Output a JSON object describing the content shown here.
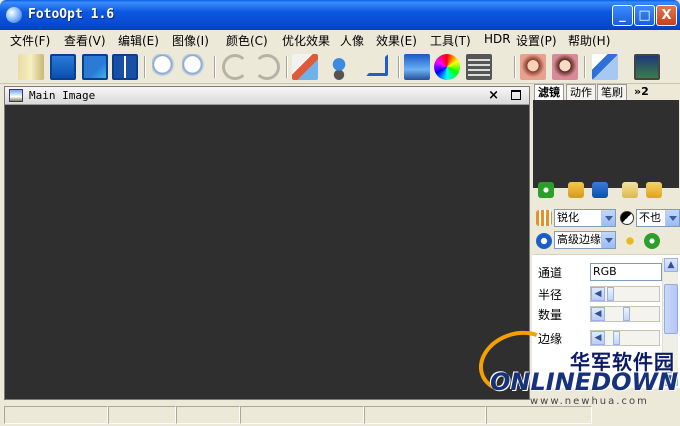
{
  "window": {
    "title": "FotoOpt 1.6",
    "minimize": "_",
    "maximize": "□",
    "close": "X"
  },
  "menu": [
    "文件(F)",
    "查看(V)",
    "编辑(E)",
    "图像(I)",
    "颜色(C)",
    "优化效果",
    "人像",
    "效果(E)",
    "工具(T)",
    "HDR",
    "设置(P)",
    "帮助(H)"
  ],
  "toolbar": {
    "icons": [
      "open-icon",
      "save-icon",
      "save-as-icon",
      "compare-icon",
      "zoom-in-icon",
      "zoom-out-icon",
      "undo-icon",
      "redo-icon",
      "resize-icon",
      "brush-icon",
      "crop-icon",
      "landscape-icon",
      "color-wheel-icon",
      "film-icon",
      "portrait-icon",
      "portrait-beauty-icon",
      "pen-icon",
      "export-icon"
    ]
  },
  "main_image": {
    "title": "Main Image",
    "close": "×"
  },
  "panel": {
    "tabs": [
      "滤镜",
      "动作",
      "笔刷",
      "»2"
    ],
    "filter_combo": "锐化",
    "mode_combo": "不也",
    "edge_combo": "高级边缘",
    "params": [
      {
        "label": "通道",
        "value": "RGB"
      },
      {
        "label": "半径",
        "value": ""
      },
      {
        "label": "数量",
        "value": ""
      },
      {
        "label": "边缘",
        "value": ""
      }
    ]
  },
  "watermark": {
    "cn": "华军软件园",
    "en": "ONLINEDOWN",
    "url": "www.newhua.com"
  },
  "colors": {
    "title_bar": "#0a5fe8",
    "canvas": "#2f2f2f",
    "face": "#ece9d8",
    "logo_orange": "#f5a000"
  }
}
